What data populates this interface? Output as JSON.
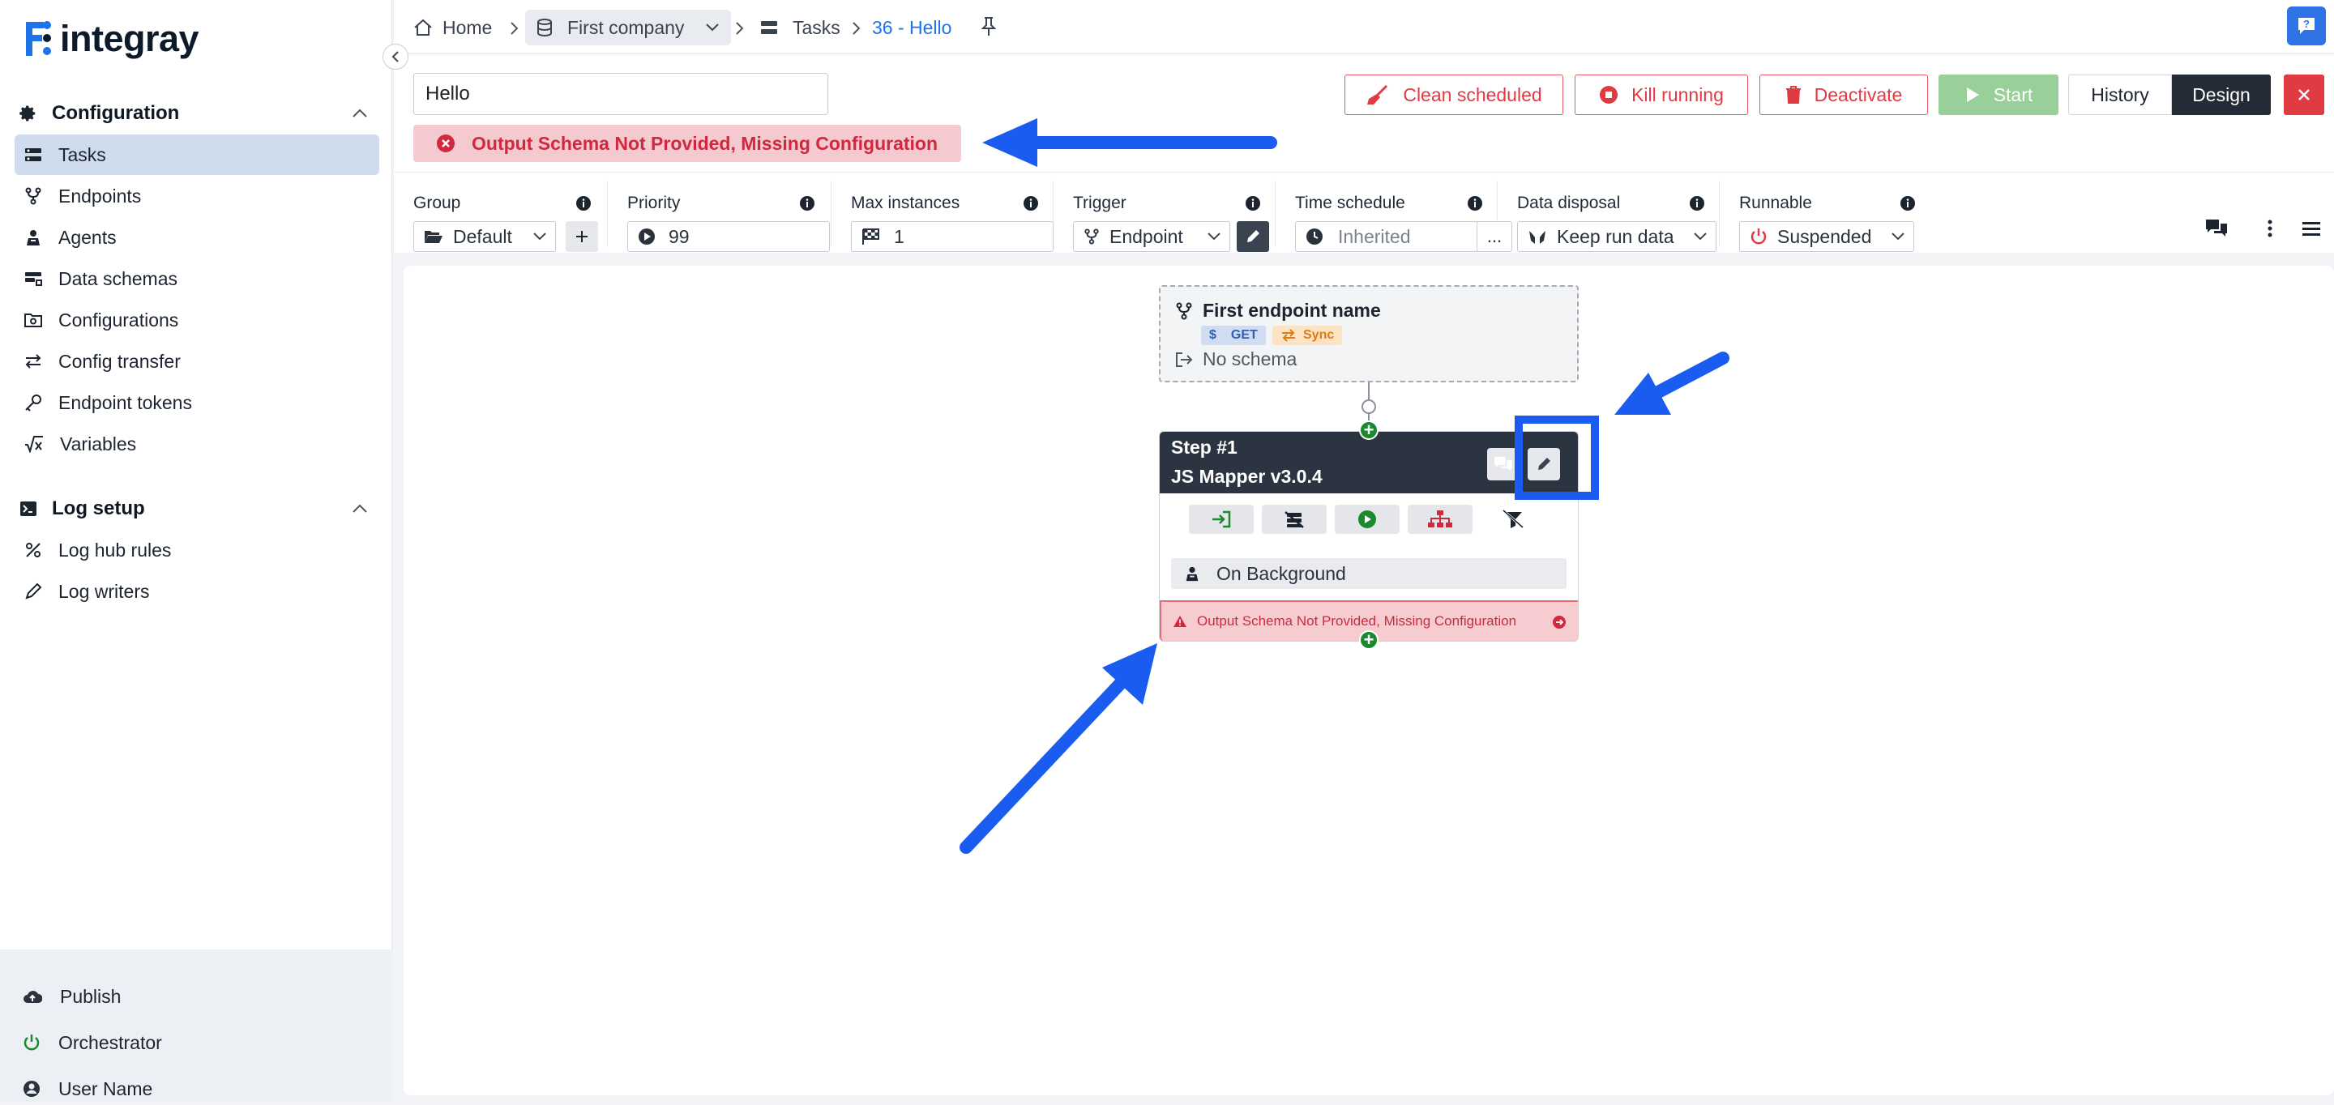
{
  "app": {
    "name": "integray"
  },
  "sidebar": {
    "sections": [
      {
        "title": "Configuration",
        "items": [
          {
            "label": "Tasks",
            "icon": "tasks-icon",
            "active": true
          },
          {
            "label": "Endpoints",
            "icon": "endpoints-icon"
          },
          {
            "label": "Agents",
            "icon": "agent-icon"
          },
          {
            "label": "Data schemas",
            "icon": "data-schemas-icon"
          },
          {
            "label": "Configurations",
            "icon": "configurations-icon"
          },
          {
            "label": "Config transfer",
            "icon": "transfer-icon"
          },
          {
            "label": "Endpoint tokens",
            "icon": "key-icon"
          },
          {
            "label": "Variables",
            "icon": "variables-icon"
          }
        ]
      },
      {
        "title": "Log setup",
        "items": [
          {
            "label": "Log hub rules",
            "icon": "log-hub-icon"
          },
          {
            "label": "Log writers",
            "icon": "pen-icon"
          }
        ]
      }
    ],
    "bottom": [
      {
        "label": "Publish",
        "icon": "cloud-upload-icon"
      },
      {
        "label": "Orchestrator",
        "icon": "power-icon"
      },
      {
        "label": "User Name",
        "icon": "user-icon"
      }
    ]
  },
  "breadcrumb": {
    "home": "Home",
    "company": "First company",
    "tasks": "Tasks",
    "current": "36 - Hello"
  },
  "task": {
    "name": "Hello",
    "error": "Output Schema Not Provided, Missing Configuration"
  },
  "toolbar": {
    "clean_scheduled": "Clean scheduled",
    "kill_running": "Kill running",
    "deactivate": "Deactivate",
    "start": "Start",
    "history": "History",
    "design": "Design"
  },
  "settings": {
    "group": {
      "label": "Group",
      "value": "Default"
    },
    "priority": {
      "label": "Priority",
      "value": "99"
    },
    "max_instances": {
      "label": "Max instances",
      "value": "1"
    },
    "trigger": {
      "label": "Trigger",
      "value": "Endpoint"
    },
    "time_schedule": {
      "label": "Time schedule",
      "value": "Inherited",
      "more": "..."
    },
    "data_disposal": {
      "label": "Data disposal",
      "value": "Keep run data"
    },
    "runnable": {
      "label": "Runnable",
      "value": "Suspended"
    }
  },
  "flow": {
    "trigger_node": {
      "title": "First endpoint name",
      "method": "GET",
      "mode": "Sync",
      "schema": "No schema"
    },
    "step_node": {
      "step": "Step #1",
      "name": "JS Mapper v3.0.4",
      "background": "On Background",
      "error": "Output Schema Not Provided, Missing Configuration"
    }
  },
  "colors": {
    "accent": "#1e73e8",
    "danger": "#e03a43",
    "success": "#99d099",
    "dark": "#232b36",
    "annotation": "#1a5cf0"
  }
}
